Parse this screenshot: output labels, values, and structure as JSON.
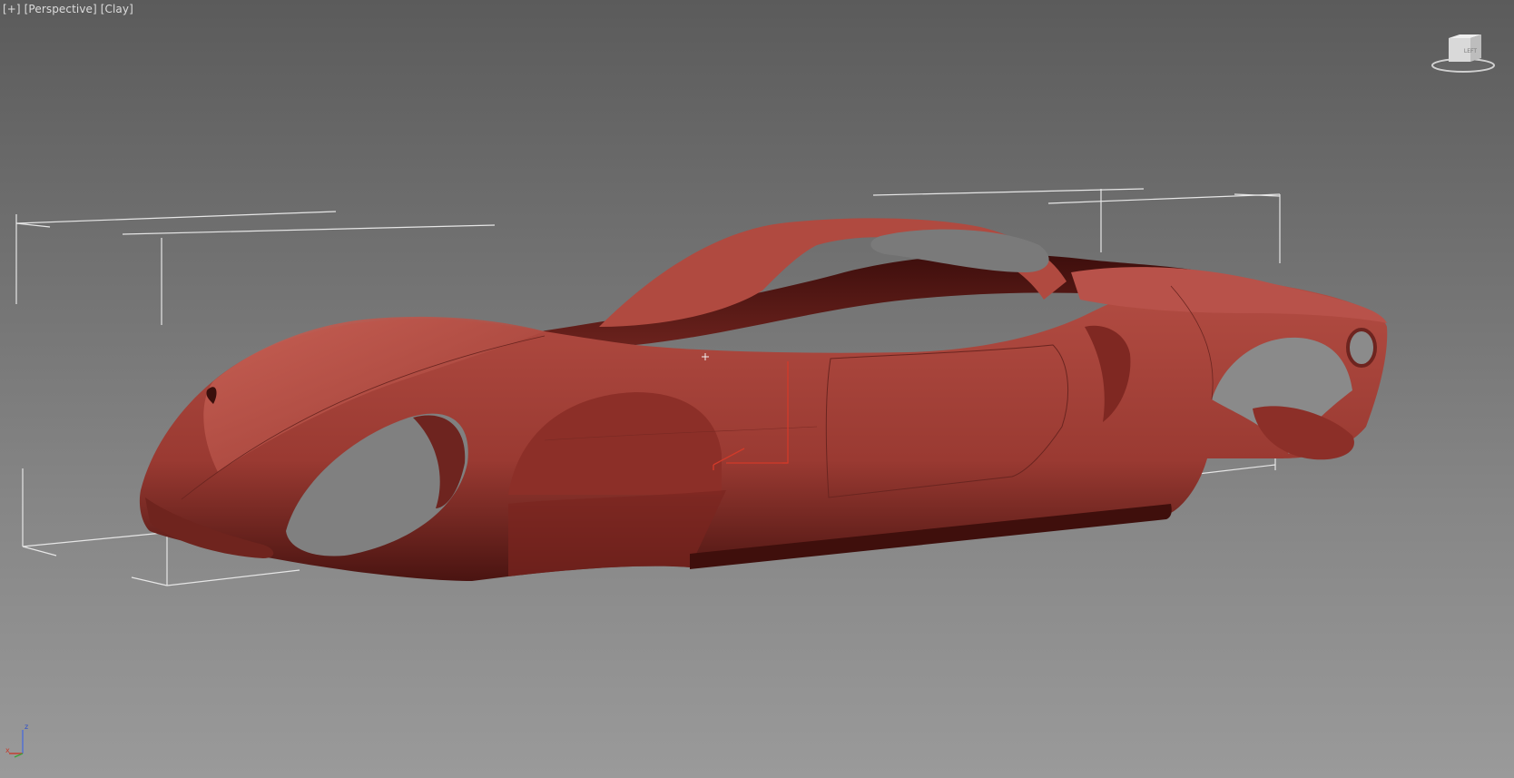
{
  "viewport": {
    "menu": {
      "plus": "[+]",
      "view": "[Perspective]",
      "shading": "[Clay]"
    },
    "background_top": "#5b5b5b",
    "background_bottom": "#9a9a9a"
  },
  "model": {
    "body_color": "#a8443b",
    "shadow_color": "#5a1a16",
    "highlight_color": "#c0574c",
    "selection_box_color": "#e6e6e6",
    "gizmo_color": "#d23a2a"
  },
  "viewcube": {
    "face_label": "LEFT",
    "icon": "viewcube-icon"
  },
  "axis_tripod": {
    "z_label": "z",
    "x_label": "x",
    "icon": "axis-tripod-icon"
  }
}
